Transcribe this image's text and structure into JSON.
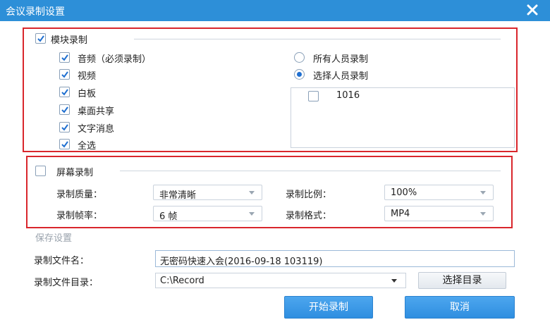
{
  "window": {
    "title": "会议录制设置",
    "close_icon": "close-icon"
  },
  "module": {
    "label": "模块录制",
    "checked": true,
    "items": [
      {
        "label": "音频（必须录制）",
        "checked": true
      },
      {
        "label": "视频",
        "checked": true
      },
      {
        "label": "白板",
        "checked": true
      },
      {
        "label": "桌面共享",
        "checked": true
      },
      {
        "label": "文字消息",
        "checked": true
      },
      {
        "label": "全选",
        "checked": true
      }
    ],
    "record_all_label": "所有人员录制",
    "record_selected_label": "选择人员录制",
    "selected_option": "选择人员录制",
    "members": [
      {
        "name": "1016",
        "checked": false
      }
    ]
  },
  "screen": {
    "label": "屏幕录制",
    "checked": false,
    "quality_label": "录制质量：",
    "quality_value": "非常清晰",
    "ratio_label": "录制比例：",
    "ratio_value": "100%",
    "fps_label": "录制帧率：",
    "fps_value": "6 帧",
    "format_label": "录制格式：",
    "format_value": "MP4"
  },
  "save": {
    "section_label": "保存设置",
    "filename_label": "录制文件名：",
    "filename_value": "无密码快速入会(2016-09-18 103119)",
    "dir_label": "录制文件目录：",
    "dir_value": "C:\\Record",
    "choose_dir_button": "选择目录"
  },
  "actions": {
    "start_button": "开始录制",
    "cancel_button": "取消"
  },
  "colors": {
    "titlebar": "#2d8fd8",
    "highlight_frame": "#d9262c",
    "primary_button": "#3a96e4"
  }
}
